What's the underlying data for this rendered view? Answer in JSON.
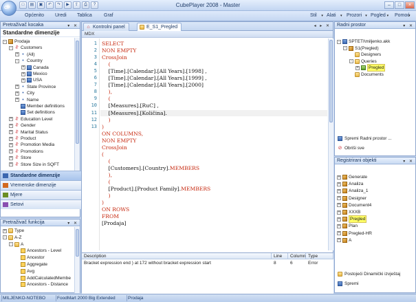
{
  "window": {
    "title": "CubePlayer 2008 - Master",
    "app_button_label": "CP"
  },
  "quick_access": [
    "new-icon",
    "open-icon",
    "save-icon",
    "undo-icon",
    "redo-icon",
    "run-icon",
    "export-icon",
    "print-icon",
    "help-icon"
  ],
  "menu": {
    "left": [
      "Općenito",
      "Uredi",
      "Tablica",
      "Graf"
    ],
    "right": [
      "Stil",
      "Alati",
      "Prozori",
      "Pogled",
      "Pomoć"
    ]
  },
  "left_top": {
    "header": "Pretraživač kocaka",
    "section_title": "Standardne dimenzije",
    "tree": [
      {
        "label": "Prodaja",
        "icon": "cube-icon",
        "indent": 0,
        "expander": "-"
      },
      {
        "label": "Customers",
        "icon": "dimension-icon",
        "indent": 1,
        "expander": "-"
      },
      {
        "label": "(All)",
        "icon": "level-icon",
        "indent": 2,
        "expander": "+"
      },
      {
        "label": "Country",
        "icon": "level-icon",
        "indent": 2,
        "expander": "-"
      },
      {
        "label": "Canada",
        "icon": "member-icon",
        "indent": 3,
        "expander": "+"
      },
      {
        "label": "Mexico",
        "icon": "member-icon",
        "indent": 3,
        "expander": "+"
      },
      {
        "label": "USA",
        "icon": "member-icon",
        "indent": 3,
        "expander": "+"
      },
      {
        "label": "State Province",
        "icon": "level-icon",
        "indent": 2,
        "expander": "+"
      },
      {
        "label": "City",
        "icon": "level-icon",
        "indent": 2,
        "expander": "+"
      },
      {
        "label": "Name",
        "icon": "level-icon",
        "indent": 2,
        "expander": "+"
      },
      {
        "label": "Member definitions",
        "icon": "hierarchy-icon",
        "indent": 2,
        "expander": ""
      },
      {
        "label": "Set definitions",
        "icon": "hierarchy-icon",
        "indent": 2,
        "expander": ""
      },
      {
        "label": "Education Level",
        "icon": "dimension-icon",
        "indent": 1,
        "expander": "+"
      },
      {
        "label": "Gender",
        "icon": "dimension-icon",
        "indent": 1,
        "expander": "+"
      },
      {
        "label": "Marital Status",
        "icon": "dimension-icon",
        "indent": 1,
        "expander": "+"
      },
      {
        "label": "Product",
        "icon": "dimension-icon",
        "indent": 1,
        "expander": "+"
      },
      {
        "label": "Promotion Media",
        "icon": "dimension-icon",
        "indent": 1,
        "expander": "+"
      },
      {
        "label": "Promotions",
        "icon": "dimension-icon",
        "indent": 1,
        "expander": "+"
      },
      {
        "label": "Store",
        "icon": "dimension-icon",
        "indent": 1,
        "expander": "+"
      },
      {
        "label": "Store Size in SQFT",
        "icon": "dimension-icon",
        "indent": 1,
        "expander": "+"
      }
    ],
    "nav_buttons": [
      "Standardne dimenzije",
      "Vremenske dimenzije",
      "Mjere",
      "Setovi"
    ]
  },
  "left_bottom": {
    "header": "Pretraživač funkcija",
    "tree": [
      {
        "label": "Type",
        "icon": "folder-icon",
        "indent": 0,
        "expander": "+"
      },
      {
        "label": "A-Z",
        "icon": "folder-icon",
        "indent": 0,
        "expander": "-"
      },
      {
        "label": "A",
        "icon": "folder-icon",
        "indent": 1,
        "expander": "-"
      },
      {
        "label": "Ancestors - Level",
        "icon": "function-icon",
        "indent": 2,
        "expander": ""
      },
      {
        "label": "Ancestor",
        "icon": "function-icon",
        "indent": 2,
        "expander": ""
      },
      {
        "label": "Aggregate",
        "icon": "function-icon",
        "indent": 2,
        "expander": ""
      },
      {
        "label": "Avg",
        "icon": "function-icon",
        "indent": 2,
        "expander": ""
      },
      {
        "label": "AddCalculatedMembe",
        "icon": "function-icon",
        "indent": 2,
        "expander": ""
      },
      {
        "label": "Ancestors - Distance",
        "icon": "function-icon",
        "indent": 2,
        "expander": ""
      }
    ]
  },
  "center": {
    "tabs": [
      {
        "label": "Kontrolni panel",
        "active": false
      },
      {
        "label": "E_S1_Pregled",
        "active": true
      }
    ],
    "editor_label": "MDX",
    "code_lines": [
      {
        "n": "1",
        "parts": [
          {
            "t": "SELECT",
            "c": "kw"
          }
        ]
      },
      {
        "n": "2",
        "parts": [
          {
            "t": "NON EMPTY",
            "c": "kw"
          }
        ]
      },
      {
        "n": "3",
        "parts": [
          {
            "t": "CrossJoin",
            "c": "fn"
          }
        ]
      },
      {
        "n": "4",
        "parts": [
          {
            "t": "    (",
            "c": "kw"
          }
        ]
      },
      {
        "n": "5",
        "parts": [
          {
            "t": "    [Time].[Calendar].[All Years].[1998] ,",
            "c": ""
          }
        ]
      },
      {
        "n": "6",
        "parts": [
          {
            "t": "    [Time].[Calendar].[All Years].[1999] ,",
            "c": ""
          }
        ]
      },
      {
        "n": "7",
        "parts": [
          {
            "t": "    [Time].[Calendar].[All Years].[2000]",
            "c": ""
          }
        ]
      },
      {
        "n": "8",
        "parts": [
          {
            "t": "    ),",
            "c": "kw"
          }
        ]
      },
      {
        "n": "9",
        "parts": [
          {
            "t": "    (",
            "c": "kw"
          }
        ]
      },
      {
        "n": "10",
        "parts": [
          {
            "t": "    [Measures].[RuC] ,",
            "c": ""
          }
        ]
      },
      {
        "n": "11",
        "parts": [
          {
            "t": "    [Measures].[Količina].",
            "c": ""
          }
        ]
      },
      {
        "n": "12",
        "parts": [
          {
            "t": "    )",
            "c": "kw"
          }
        ]
      },
      {
        "n": "13",
        "parts": [
          {
            "t": ")",
            "c": "kw"
          }
        ]
      },
      {
        "n": "",
        "parts": [
          {
            "t": "ON COLUMNS,",
            "c": "kw"
          }
        ]
      },
      {
        "n": "",
        "parts": [
          {
            "t": "NON EMPTY",
            "c": "kw"
          }
        ]
      },
      {
        "n": "",
        "parts": [
          {
            "t": "CrossJoin",
            "c": "fn"
          }
        ]
      },
      {
        "n": "",
        "parts": [
          {
            "t": "(",
            "c": "kw"
          }
        ]
      },
      {
        "n": "",
        "parts": [
          {
            "t": "    (",
            "c": "kw"
          }
        ]
      },
      {
        "n": "",
        "parts": [
          {
            "t": "    [Customers].[Country].",
            "c": ""
          },
          {
            "t": "MEMBERS",
            "c": "mb"
          }
        ]
      },
      {
        "n": "",
        "parts": [
          {
            "t": "    ),",
            "c": "kw"
          }
        ]
      },
      {
        "n": "",
        "parts": [
          {
            "t": "    (",
            "c": "kw"
          }
        ]
      },
      {
        "n": "",
        "parts": [
          {
            "t": "    [Product].[Product Family].",
            "c": ""
          },
          {
            "t": "MEMBERS",
            "c": "mb"
          }
        ]
      },
      {
        "n": "",
        "parts": [
          {
            "t": "    )",
            "c": "kw"
          }
        ]
      },
      {
        "n": "",
        "parts": [
          {
            "t": ")",
            "c": "kw"
          }
        ]
      },
      {
        "n": "",
        "parts": [
          {
            "t": "ON ROWS",
            "c": "kw"
          }
        ]
      },
      {
        "n": "",
        "parts": [
          {
            "t": "FROM",
            "c": "kw"
          }
        ]
      },
      {
        "n": "",
        "parts": [
          {
            "t": "[Prodaja]",
            "c": ""
          }
        ]
      }
    ],
    "error_list": {
      "columns": [
        "Description",
        "Line",
        "Column",
        "Type"
      ],
      "rows": [
        [
          "Bracket expression end ) at 172 without bracket expression start",
          "8",
          "6",
          "Error"
        ]
      ]
    }
  },
  "right_top": {
    "header": "Radni prostor",
    "tree": [
      {
        "label": "SPTETI\\miljenko.akk",
        "indent": 0,
        "icon": "workspace-icon",
        "expander": "-"
      },
      {
        "label": "S1(Pregled)",
        "indent": 1,
        "icon": "cube-icon",
        "expander": "-"
      },
      {
        "label": "Designers",
        "indent": 2,
        "icon": "folder-icon",
        "expander": ""
      },
      {
        "label": "Queries",
        "indent": 2,
        "icon": "folder-icon",
        "expander": "-"
      },
      {
        "label": "Pregled",
        "indent": 3,
        "icon": "query-icon",
        "expander": "+",
        "highlight": true
      },
      {
        "label": "Documents",
        "indent": 2,
        "icon": "folder-icon",
        "expander": ""
      }
    ],
    "buttons": [
      "Spremi Radni prostor ...",
      "Obriši sve"
    ]
  },
  "right_bottom": {
    "header": "Registrirani objekti",
    "tree": [
      {
        "label": "Generate",
        "highlight": false
      },
      {
        "label": "Analiza",
        "highlight": false
      },
      {
        "label": "Analiza_1",
        "highlight": false
      },
      {
        "label": "Designer",
        "highlight": false
      },
      {
        "label": "Document4",
        "highlight": false
      },
      {
        "label": "XXXB",
        "highlight": false
      },
      {
        "label": "Pregled",
        "highlight": true
      },
      {
        "label": "Plan",
        "highlight": false
      },
      {
        "label": "Pregled-HR",
        "highlight": false
      },
      {
        "label": "A",
        "highlight": false
      }
    ],
    "buttons": [
      "Postojeći Dinamički izvještaj",
      "Spremi"
    ]
  },
  "statusbar": {
    "items": [
      "MILJENKO-NOTEBO",
      "FoodMart 2000 Big Extended",
      "Prodaja"
    ]
  },
  "colors": {
    "keyword": "#c6260c",
    "line_number": "#2b7a9e",
    "highlight": "#ffff66",
    "frame": "#c5d6ef"
  }
}
